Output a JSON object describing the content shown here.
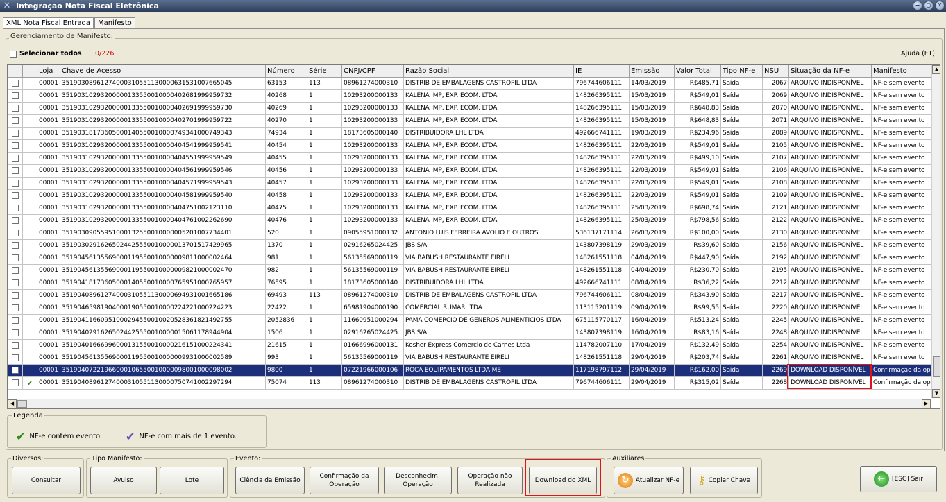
{
  "window": {
    "title": "Integração Nota Fiscal Eletrônica",
    "controls": [
      "min",
      "restore",
      "close"
    ]
  },
  "tabs": [
    {
      "label": "XML Nota Fiscal Entrada",
      "active": true
    },
    {
      "label": "Manifesto",
      "active": false
    }
  ],
  "manager": {
    "legend": "Gerenciamento de Manifesto:",
    "select_all": "Selecionar todos",
    "count": "0/226",
    "help": "Ajuda (F1)"
  },
  "columns": [
    "",
    "",
    "Loja",
    "Chave de Acesso",
    "Número",
    "Série",
    "CNPJ/CPF",
    "Razão Social",
    "IE",
    "Emissão",
    "Valor Total",
    "Tipo NF-e",
    "NSU",
    "Situação da NF-e",
    "Manifesto"
  ],
  "rows": [
    {
      "check": "",
      "loja": "00001",
      "chave": "35190308961274000310551130000631531007665045",
      "numero": "63153",
      "serie": "113",
      "cnpj": "08961274000310",
      "razao": "DISTRIB DE EMBALAGENS CASTROPIL LTDA",
      "ie": "796744606111",
      "emissao": "14/03/2019",
      "valor": "R$485,71",
      "tipo": "Saída",
      "nsu": "2067",
      "situacao": "ARQUIVO INDISPONÍVEL",
      "manifesto": "NF-e sem evento"
    },
    {
      "check": "",
      "loja": "00001",
      "chave": "35190310293200000133550010000402681999959732",
      "numero": "40268",
      "serie": "1",
      "cnpj": "10293200000133",
      "razao": "KALENA IMP, EXP. ECOM. LTDA",
      "ie": "148266395111",
      "emissao": "15/03/2019",
      "valor": "R$549,01",
      "tipo": "Saída",
      "nsu": "2069",
      "situacao": "ARQUIVO INDISPONÍVEL",
      "manifesto": "NF-e sem evento"
    },
    {
      "check": "",
      "loja": "00001",
      "chave": "35190310293200000133550010000402691999959730",
      "numero": "40269",
      "serie": "1",
      "cnpj": "10293200000133",
      "razao": "KALENA IMP, EXP. ECOM. LTDA",
      "ie": "148266395111",
      "emissao": "15/03/2019",
      "valor": "R$648,83",
      "tipo": "Saída",
      "nsu": "2070",
      "situacao": "ARQUIVO INDISPONÍVEL",
      "manifesto": "NF-e sem evento"
    },
    {
      "check": "",
      "loja": "00001",
      "chave": "35190310293200000133550010000402701999959722",
      "numero": "40270",
      "serie": "1",
      "cnpj": "10293200000133",
      "razao": "KALENA IMP, EXP. ECOM. LTDA",
      "ie": "148266395111",
      "emissao": "15/03/2019",
      "valor": "R$648,83",
      "tipo": "Saída",
      "nsu": "2071",
      "situacao": "ARQUIVO INDISPONÍVEL",
      "manifesto": "NF-e sem evento"
    },
    {
      "check": "",
      "loja": "00001",
      "chave": "35190318173605000140550010000749341000749343",
      "numero": "74934",
      "serie": "1",
      "cnpj": "18173605000140",
      "razao": "DISTRIBUIDORA LHL LTDA",
      "ie": "492666741111",
      "emissao": "19/03/2019",
      "valor": "R$234,96",
      "tipo": "Saída",
      "nsu": "2089",
      "situacao": "ARQUIVO INDISPONÍVEL",
      "manifesto": "NF-e sem evento"
    },
    {
      "check": "",
      "loja": "00001",
      "chave": "35190310293200000133550010000404541999959541",
      "numero": "40454",
      "serie": "1",
      "cnpj": "10293200000133",
      "razao": "KALENA IMP, EXP. ECOM. LTDA",
      "ie": "148266395111",
      "emissao": "22/03/2019",
      "valor": "R$549,01",
      "tipo": "Saída",
      "nsu": "2105",
      "situacao": "ARQUIVO INDISPONÍVEL",
      "manifesto": "NF-e sem evento"
    },
    {
      "check": "",
      "loja": "00001",
      "chave": "35190310293200000133550010000404551999959549",
      "numero": "40455",
      "serie": "1",
      "cnpj": "10293200000133",
      "razao": "KALENA IMP, EXP. ECOM. LTDA",
      "ie": "148266395111",
      "emissao": "22/03/2019",
      "valor": "R$499,10",
      "tipo": "Saída",
      "nsu": "2107",
      "situacao": "ARQUIVO INDISPONÍVEL",
      "manifesto": "NF-e sem evento"
    },
    {
      "check": "",
      "loja": "00001",
      "chave": "35190310293200000133550010000404561999959546",
      "numero": "40456",
      "serie": "1",
      "cnpj": "10293200000133",
      "razao": "KALENA IMP, EXP. ECOM. LTDA",
      "ie": "148266395111",
      "emissao": "22/03/2019",
      "valor": "R$549,01",
      "tipo": "Saída",
      "nsu": "2106",
      "situacao": "ARQUIVO INDISPONÍVEL",
      "manifesto": "NF-e sem evento"
    },
    {
      "check": "",
      "loja": "00001",
      "chave": "35190310293200000133550010000404571999959543",
      "numero": "40457",
      "serie": "1",
      "cnpj": "10293200000133",
      "razao": "KALENA IMP, EXP. ECOM. LTDA",
      "ie": "148266395111",
      "emissao": "22/03/2019",
      "valor": "R$549,01",
      "tipo": "Saída",
      "nsu": "2108",
      "situacao": "ARQUIVO INDISPONÍVEL",
      "manifesto": "NF-e sem evento"
    },
    {
      "check": "",
      "loja": "00001",
      "chave": "35190310293200000133550010000404581999959540",
      "numero": "40458",
      "serie": "1",
      "cnpj": "10293200000133",
      "razao": "KALENA IMP, EXP. ECOM. LTDA",
      "ie": "148266395111",
      "emissao": "22/03/2019",
      "valor": "R$549,01",
      "tipo": "Saída",
      "nsu": "2109",
      "situacao": "ARQUIVO INDISPONÍVEL",
      "manifesto": "NF-e sem evento"
    },
    {
      "check": "",
      "loja": "00001",
      "chave": "35190310293200000133550010000404751002123110",
      "numero": "40475",
      "serie": "1",
      "cnpj": "10293200000133",
      "razao": "KALENA IMP, EXP. ECOM. LTDA",
      "ie": "148266395111",
      "emissao": "25/03/2019",
      "valor": "R$698,74",
      "tipo": "Saída",
      "nsu": "2121",
      "situacao": "ARQUIVO INDISPONÍVEL",
      "manifesto": "NF-e sem evento"
    },
    {
      "check": "",
      "loja": "00001",
      "chave": "35190310293200000133550010000404761002262690",
      "numero": "40476",
      "serie": "1",
      "cnpj": "10293200000133",
      "razao": "KALENA IMP, EXP. ECOM. LTDA",
      "ie": "148266395111",
      "emissao": "25/03/2019",
      "valor": "R$798,56",
      "tipo": "Saída",
      "nsu": "2122",
      "situacao": "ARQUIVO INDISPONÍVEL",
      "manifesto": "NF-e sem evento"
    },
    {
      "check": "",
      "loja": "00001",
      "chave": "35190309055951000132550010000005201007734401",
      "numero": "520",
      "serie": "1",
      "cnpj": "09055951000132",
      "razao": "ANTONIO LUIS FERREIRA AVOLIO E OUTROS",
      "ie": "536137171114",
      "emissao": "26/03/2019",
      "valor": "R$100,00",
      "tipo": "Saída",
      "nsu": "2130",
      "situacao": "ARQUIVO INDISPONÍVEL",
      "manifesto": "NF-e sem evento"
    },
    {
      "check": "",
      "loja": "00001",
      "chave": "35190302916265024425550010000013701517429965",
      "numero": "1370",
      "serie": "1",
      "cnpj": "02916265024425",
      "razao": "JBS S/A",
      "ie": "143807398119",
      "emissao": "29/03/2019",
      "valor": "R$39,60",
      "tipo": "Saída",
      "nsu": "2156",
      "situacao": "ARQUIVO INDISPONÍVEL",
      "manifesto": "NF-e sem evento"
    },
    {
      "check": "",
      "loja": "00001",
      "chave": "35190456135569000119550010000009811000002464",
      "numero": "981",
      "serie": "1",
      "cnpj": "56135569000119",
      "razao": "VIA BABUSH RESTAURANTE EIRELI",
      "ie": "148261551118",
      "emissao": "04/04/2019",
      "valor": "R$447,90",
      "tipo": "Saída",
      "nsu": "2192",
      "situacao": "ARQUIVO INDISPONÍVEL",
      "manifesto": "NF-e sem evento"
    },
    {
      "check": "",
      "loja": "00001",
      "chave": "35190456135569000119550010000009821000002470",
      "numero": "982",
      "serie": "1",
      "cnpj": "56135569000119",
      "razao": "VIA BABUSH RESTAURANTE EIRELI",
      "ie": "148261551118",
      "emissao": "04/04/2019",
      "valor": "R$230,70",
      "tipo": "Saída",
      "nsu": "2195",
      "situacao": "ARQUIVO INDISPONÍVEL",
      "manifesto": "NF-e sem evento"
    },
    {
      "check": "",
      "loja": "00001",
      "chave": "35190418173605000140550010000765951000765957",
      "numero": "76595",
      "serie": "1",
      "cnpj": "18173605000140",
      "razao": "DISTRIBUIDORA LHL LTDA",
      "ie": "492666741111",
      "emissao": "08/04/2019",
      "valor": "R$36,22",
      "tipo": "Saída",
      "nsu": "2212",
      "situacao": "ARQUIVO INDISPONÍVEL",
      "manifesto": "NF-e sem evento"
    },
    {
      "check": "",
      "loja": "00001",
      "chave": "35190408961274000310551130000694931001665186",
      "numero": "69493",
      "serie": "113",
      "cnpj": "08961274000310",
      "razao": "DISTRIB DE EMBALAGENS CASTROPIL LTDA",
      "ie": "796744606111",
      "emissao": "08/04/2019",
      "valor": "R$343,90",
      "tipo": "Saída",
      "nsu": "2217",
      "situacao": "ARQUIVO INDISPONÍVEL",
      "manifesto": "NF-e sem evento"
    },
    {
      "check": "",
      "loja": "00001",
      "chave": "35190465981904000190550010000224221000224223",
      "numero": "22422",
      "serie": "1",
      "cnpj": "65981904000190",
      "razao": "COMERCIAL RUMAR LTDA",
      "ie": "113115201119",
      "emissao": "09/04/2019",
      "valor": "R$99,55",
      "tipo": "Saída",
      "nsu": "2220",
      "situacao": "ARQUIVO INDISPONÍVEL",
      "manifesto": "NF-e sem evento"
    },
    {
      "check": "",
      "loja": "00001",
      "chave": "35190411660951000294550010020528361821492755",
      "numero": "2052836",
      "serie": "1",
      "cnpj": "11660951000294",
      "razao": "PAMA COMERCIO DE GENEROS ALIMENTICIOS LTDA",
      "ie": "675115770117",
      "emissao": "16/04/2019",
      "valor": "R$513,24",
      "tipo": "Saída",
      "nsu": "2245",
      "situacao": "ARQUIVO INDISPONÍVEL",
      "manifesto": "NF-e sem evento"
    },
    {
      "check": "",
      "loja": "00001",
      "chave": "35190402916265024425550010000015061178944904",
      "numero": "1506",
      "serie": "1",
      "cnpj": "02916265024425",
      "razao": "JBS S/A",
      "ie": "143807398119",
      "emissao": "16/04/2019",
      "valor": "R$83,16",
      "tipo": "Saída",
      "nsu": "2248",
      "situacao": "ARQUIVO INDISPONÍVEL",
      "manifesto": "NF-e sem evento"
    },
    {
      "check": "",
      "loja": "00001",
      "chave": "35190401666996000131550010000216151000224341",
      "numero": "21615",
      "serie": "1",
      "cnpj": "01666996000131",
      "razao": "Kosher Express Comercio de Carnes Ltda",
      "ie": "114782007110",
      "emissao": "17/04/2019",
      "valor": "R$132,49",
      "tipo": "Saída",
      "nsu": "2254",
      "situacao": "ARQUIVO INDISPONÍVEL",
      "manifesto": "NF-e sem evento"
    },
    {
      "check": "",
      "loja": "00001",
      "chave": "35190456135569000119550010000009931000002589",
      "numero": "993",
      "serie": "1",
      "cnpj": "56135569000119",
      "razao": "VIA BABUSH RESTAURANTE EIRELI",
      "ie": "148261551118",
      "emissao": "29/04/2019",
      "valor": "R$203,74",
      "tipo": "Saída",
      "nsu": "2261",
      "situacao": "ARQUIVO INDISPONÍVEL",
      "manifesto": "NF-e sem evento"
    },
    {
      "check": "",
      "loja": "00001",
      "chave": "35190407221966000106550010000098001000098002",
      "numero": "9800",
      "serie": "1",
      "cnpj": "07221966000106",
      "razao": "ROCA EQUIPAMENTOS LTDA  ME",
      "ie": "117198797112",
      "emissao": "29/04/2019",
      "valor": "R$162,00",
      "tipo": "Saída",
      "nsu": "2269",
      "situacao": "DOWNLOAD DISPONÍVEL",
      "manifesto": "Confirmação da op"
    },
    {
      "check": "✔",
      "loja": "00001",
      "chave": "35190408961274000310551130000750741002297294",
      "numero": "75074",
      "serie": "113",
      "cnpj": "08961274000310",
      "razao": "DISTRIB DE EMBALAGENS CASTROPIL LTDA",
      "ie": "796744606111",
      "emissao": "29/04/2019",
      "valor": "R$315,02",
      "tipo": "Saída",
      "nsu": "2268",
      "situacao": "DOWNLOAD DISPONÍVEL",
      "manifesto": "Confirmação da op"
    }
  ],
  "selected_row": 23,
  "legend": {
    "title": "Legenda",
    "item1": "NF-e contém evento",
    "item2": "NF-e com mais de 1 evento."
  },
  "groups": {
    "diversos": {
      "title": "Diversos:",
      "consultar": "Consultar"
    },
    "tipo": {
      "title": "Tipo Manifesto:",
      "avulso": "Avulso",
      "lote": "Lote"
    },
    "evento": {
      "title": "Evento:",
      "ciencia": "Ciência da Emissão",
      "confirmacao": "Confirmação da Operação",
      "desconhecimento": "Desconhecim. Operação",
      "nao_realizada": "Operação não Realizada",
      "download": "Download do XML"
    },
    "auxiliares": {
      "title": "Auxiliares",
      "atualizar": "Atualizar NF-e",
      "copiar": "Copiar Chave"
    },
    "sair": "[ESC] Sair"
  },
  "colors": {
    "selected_row": "#1c2f7a",
    "highlight": "#e0121a",
    "check_single": "#2a8a1a",
    "check_multi": "#6a4bbf"
  }
}
